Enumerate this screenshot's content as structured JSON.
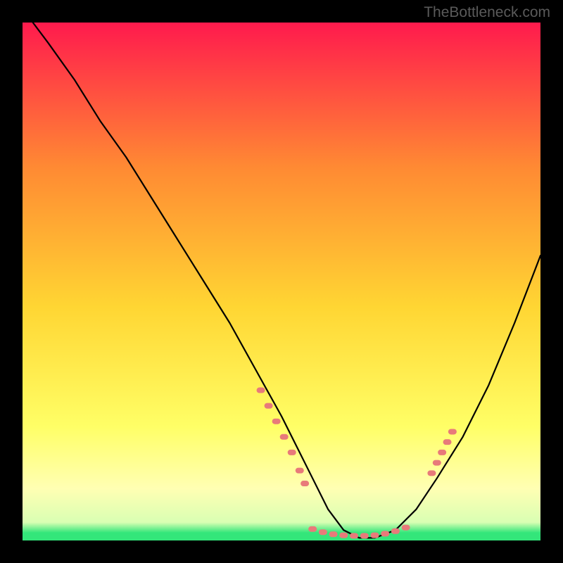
{
  "watermark": "TheBottleneck.com",
  "chart_data": {
    "type": "line",
    "title": "",
    "xlabel": "",
    "ylabel": "",
    "xlim": [
      0,
      100
    ],
    "ylim": [
      0,
      100
    ],
    "background_gradient": {
      "top": "#ff1a4d",
      "mid_upper": "#ff8a33",
      "mid": "#ffd633",
      "mid_lower": "#ffff66",
      "lower": "#ffffb3",
      "bottom": "#33e67a"
    },
    "series": [
      {
        "name": "bottleneck-curve",
        "color": "#000000",
        "x": [
          2,
          5,
          10,
          15,
          20,
          25,
          30,
          35,
          40,
          45,
          50,
          53,
          56,
          59,
          62,
          65,
          68,
          72,
          76,
          80,
          85,
          90,
          95,
          100
        ],
        "y": [
          100,
          96,
          89,
          81,
          74,
          66,
          58,
          50,
          42,
          33,
          24,
          18,
          12,
          6,
          2,
          0.5,
          0.5,
          2,
          6,
          12,
          20,
          30,
          42,
          55
        ]
      }
    ],
    "markers": [
      {
        "name": "left-descent-markers",
        "color": "#e87a7a",
        "points": [
          {
            "x": 46,
            "y": 29
          },
          {
            "x": 47.5,
            "y": 26
          },
          {
            "x": 49,
            "y": 23
          },
          {
            "x": 50.5,
            "y": 20
          },
          {
            "x": 52,
            "y": 17
          },
          {
            "x": 53.5,
            "y": 13.5
          },
          {
            "x": 54.5,
            "y": 11
          }
        ]
      },
      {
        "name": "valley-markers",
        "color": "#e87a7a",
        "points": [
          {
            "x": 56,
            "y": 2.2
          },
          {
            "x": 58,
            "y": 1.6
          },
          {
            "x": 60,
            "y": 1.2
          },
          {
            "x": 62,
            "y": 1.0
          },
          {
            "x": 64,
            "y": 0.9
          },
          {
            "x": 66,
            "y": 0.9
          },
          {
            "x": 68,
            "y": 1.0
          },
          {
            "x": 70,
            "y": 1.3
          },
          {
            "x": 72,
            "y": 1.8
          },
          {
            "x": 74,
            "y": 2.5
          }
        ]
      },
      {
        "name": "right-ascent-markers",
        "color": "#e87a7a",
        "points": [
          {
            "x": 79,
            "y": 13
          },
          {
            "x": 80,
            "y": 15
          },
          {
            "x": 81,
            "y": 17
          },
          {
            "x": 82,
            "y": 19
          },
          {
            "x": 83,
            "y": 21
          }
        ]
      }
    ]
  }
}
